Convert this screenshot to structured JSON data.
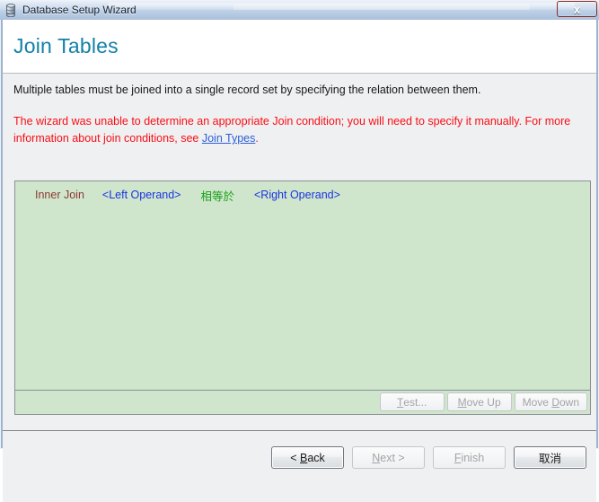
{
  "window": {
    "title": "Database Setup Wizard",
    "icon": "database-icon",
    "close_label": "x",
    "frame_color": "#9db4d0"
  },
  "header": {
    "title": "Join Tables",
    "title_color": "#1380a8"
  },
  "main": {
    "intro": "Multiple tables must be joined into a single record set by specifying the relation between them.",
    "warning_part1": "The wizard was unable to determine an appropriate Join condition; you will need to specify it manually.  For more information about join conditions, see ",
    "warning_link": "Join Types",
    "warning_part2": ".",
    "warning_color": "#fb0d13",
    "link_color": "#2b5fd9"
  },
  "join_list": {
    "background": "#cfe6cd",
    "rows": [
      {
        "join_type": "Inner Join",
        "join_type_color": "#8c3a32",
        "left_operand": "<Left Operand>",
        "left_operand_color": "#1a33e0",
        "operator": "相等於",
        "operator_color": "#18a016",
        "right_operand": "<Right Operand>",
        "right_operand_color": "#1a33e0"
      }
    ]
  },
  "list_toolbar": {
    "buttons": [
      {
        "label": "Test...",
        "mnemonic": "T",
        "enabled": false
      },
      {
        "label": "Move Up",
        "mnemonic": "M",
        "enabled": false
      },
      {
        "label": "Move Down",
        "mnemonic": "D",
        "enabled": false
      }
    ]
  },
  "nav": {
    "back": {
      "label": "< Back",
      "mnemonic": "B",
      "enabled": true
    },
    "next": {
      "label": "Next >",
      "mnemonic": "N",
      "enabled": false
    },
    "finish": {
      "label": "Finish",
      "mnemonic": "F",
      "enabled": false
    },
    "cancel": {
      "label": "取消",
      "mnemonic": "",
      "enabled": true
    }
  }
}
